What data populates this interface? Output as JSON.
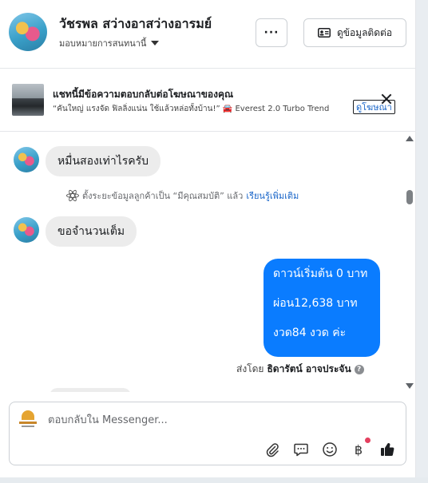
{
  "header": {
    "customer_name": "วัชรพล สว่างอาสว่างอารมย์",
    "assigned_label": "มอบหมายการสนทนานี้",
    "more_label": "···",
    "contact_button_label": "ดูข้อมูลติดต่อ"
  },
  "ad": {
    "title": "แชทนี้มีข้อความตอบกลับต่อโฆษณาของคุณ",
    "subtitle": "“คันใหญ่ แรงจัด ฟิลลิ่งแน่น ใช้แล้วหล่อทั้งบ้าน!” 🚘 Everest 2.0 Turbo Trend",
    "link_label": "ดูโฆษณา"
  },
  "messages": {
    "incoming_1": "หมื่นสองเท่าไรครับ",
    "notice_text": "ตั้งระยะข้อมูลลูกค้าเป็น “มีคุณสมบัติ” แล้ว",
    "notice_link": "เรียนรู้เพิ่มเติม",
    "incoming_2": "ขอจำนวนเต็ม",
    "outgoing_lines": [
      "ดาวน์เริ่มต้น 0 บาท",
      "ผ่อน12,638 บาท",
      "งวด84 งวด ค่ะ"
    ],
    "sent_by_prefix": "ส่งโดย",
    "sent_by_name": "ธิดารัตน์ อาจประจัน",
    "help_mark": "?"
  },
  "composer": {
    "placeholder": "ตอบกลับใน Messenger...",
    "baht_symbol": "฿"
  },
  "colors": {
    "outgoing_bubble": "#0a7cff",
    "incoming_bubble": "#ececec",
    "link": "#1a66c9",
    "notification_dot": "#e4405f"
  }
}
